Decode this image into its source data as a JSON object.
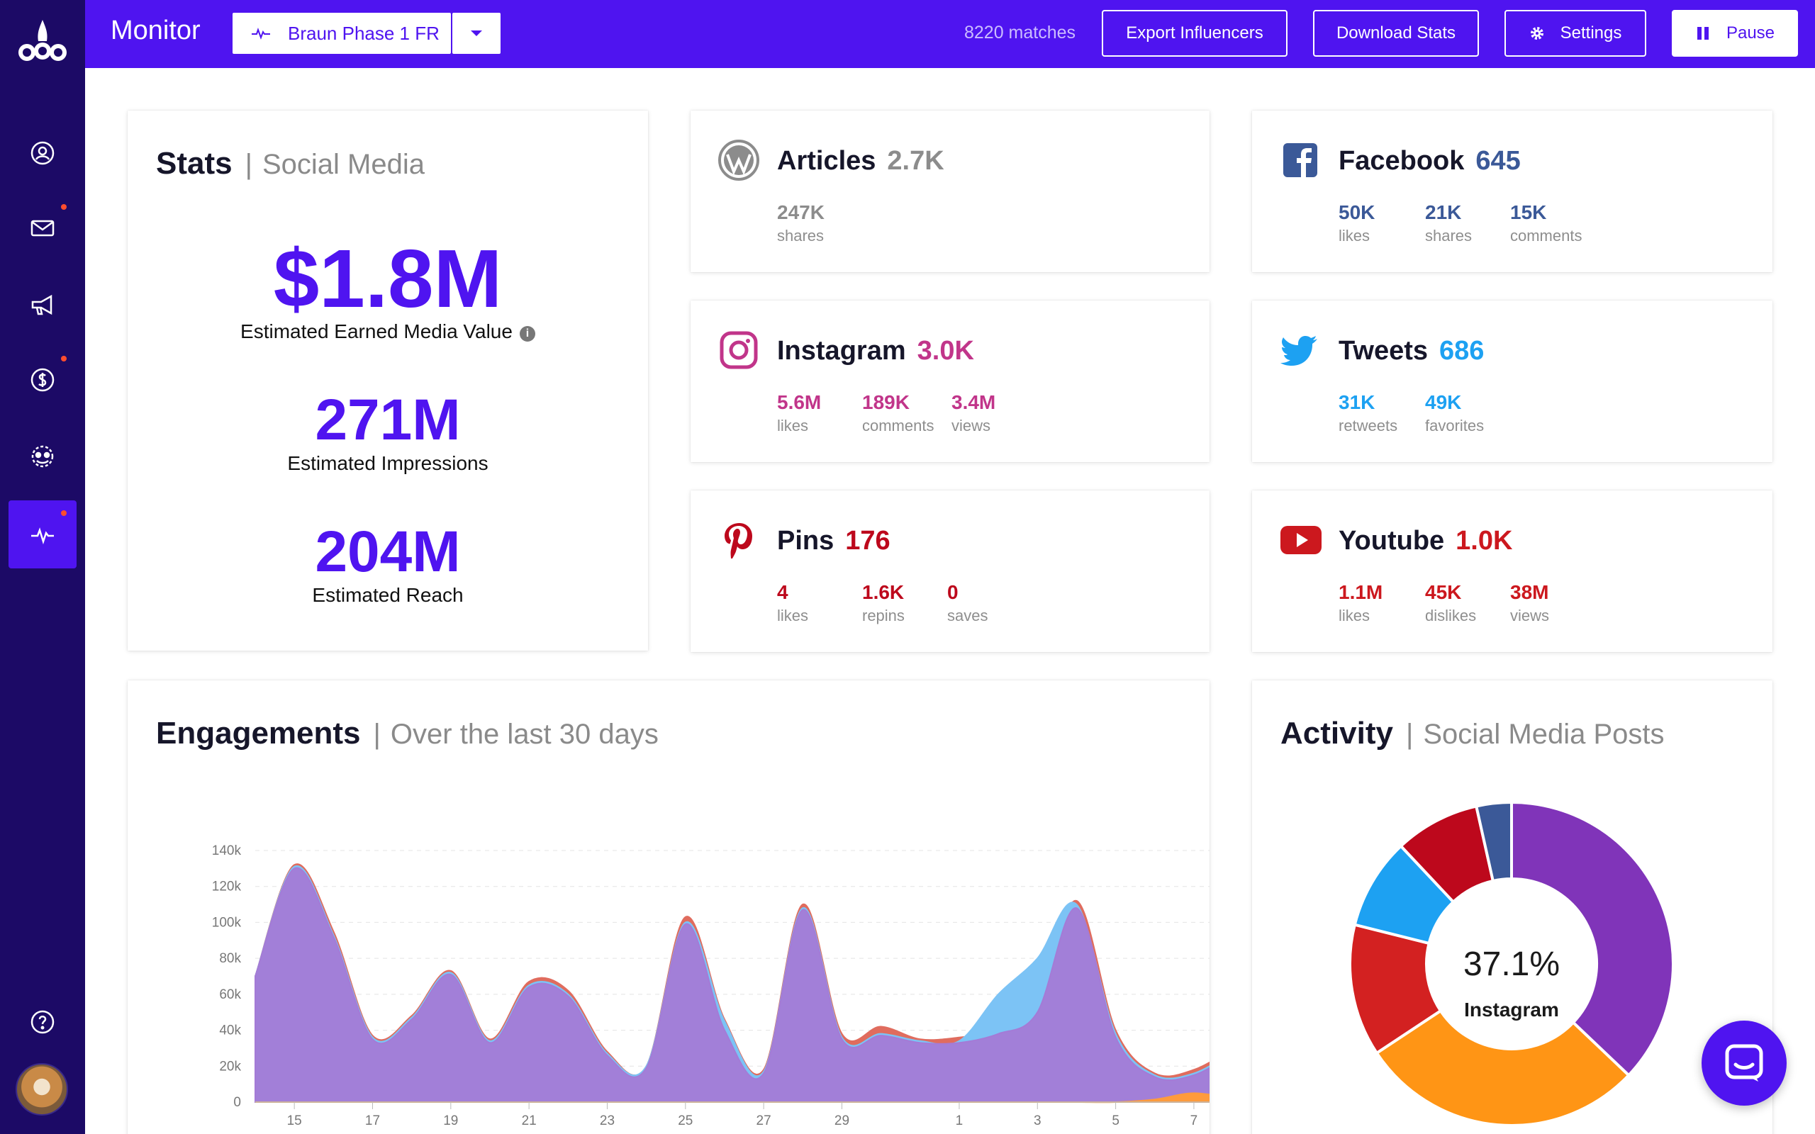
{
  "topbar": {
    "brand": "Monitor",
    "campaign": "Braun Phase 1 FR",
    "matches": "8220 matches",
    "export_label": "Export Influencers",
    "download_label": "Download Stats",
    "settings_label": "Settings",
    "pause_label": "Pause"
  },
  "sidebar": {
    "items": [
      "profile-icon",
      "mail-icon",
      "megaphone-icon",
      "dollar-icon",
      "group-icon",
      "pulse-icon",
      "help-icon"
    ],
    "active": "pulse-icon"
  },
  "stats": {
    "title": "Stats",
    "subtitle": "Social Media",
    "emv_value": "$1.8M",
    "emv_label": "Estimated Earned Media Value",
    "impressions_value": "271M",
    "impressions_label": "Estimated Impressions",
    "reach_value": "204M",
    "reach_label": "Estimated Reach"
  },
  "platforms": {
    "articles": {
      "name": "Articles",
      "count": "2.7K",
      "color": "#8c8c8c",
      "m1v": "247K",
      "m1l": "shares"
    },
    "facebook": {
      "name": "Facebook",
      "count": "645",
      "color": "#3b5998",
      "m1v": "50K",
      "m1l": "likes",
      "m2v": "21K",
      "m2l": "shares",
      "m3v": "15K",
      "m3l": "comments"
    },
    "instagram": {
      "name": "Instagram",
      "count": "3.0K",
      "color": "#c1358a",
      "m1v": "5.6M",
      "m1l": "likes",
      "m2v": "189K",
      "m2l": "comments",
      "m3v": "3.4M",
      "m3l": "views"
    },
    "tweets": {
      "name": "Tweets",
      "count": "686",
      "color": "#1da1f2",
      "m1v": "31K",
      "m1l": "retweets",
      "m2v": "49K",
      "m2l": "favorites"
    },
    "pins": {
      "name": "Pins",
      "count": "176",
      "color": "#bd081c",
      "m1v": "4",
      "m1l": "likes",
      "m2v": "1.6K",
      "m2l": "repins",
      "m3v": "0",
      "m3l": "saves"
    },
    "youtube": {
      "name": "Youtube",
      "count": "1.0K",
      "color": "#cc181e",
      "m1v": "1.1M",
      "m1l": "likes",
      "m2v": "45K",
      "m2l": "dislikes",
      "m3v": "38M",
      "m3l": "views"
    }
  },
  "engagements": {
    "title": "Engagements",
    "subtitle": "Over the last 30 days"
  },
  "activity": {
    "title": "Activity",
    "subtitle": "Social Media Posts",
    "center_value": "37.1%",
    "center_label": "Instagram"
  },
  "chart_data": [
    {
      "type": "area",
      "x": [
        "14",
        "15",
        "16",
        "17",
        "18",
        "19",
        "20",
        "21",
        "22",
        "23",
        "24",
        "25",
        "26",
        "27",
        "28",
        "29",
        "30",
        "31",
        "1",
        "2",
        "3",
        "4",
        "5",
        "6",
        "7",
        "8"
      ],
      "xticks": [
        "15",
        "17",
        "19",
        "21",
        "23",
        "25",
        "27",
        "29",
        "1",
        "3",
        "5",
        "7"
      ],
      "yticks": [
        "0",
        "20k",
        "40k",
        "60k",
        "80k",
        "100k",
        "120k",
        "140k"
      ],
      "ylim": [
        0,
        140000
      ],
      "series": [
        {
          "color": "#e06c5e",
          "values": [
            70000,
            132000,
            95000,
            37000,
            48000,
            73000,
            35000,
            67000,
            62000,
            28000,
            20000,
            103000,
            46000,
            18000,
            110000,
            38000,
            42000,
            35000,
            36000,
            40000,
            55000,
            112000,
            40000,
            16000,
            18000,
            30000
          ]
        },
        {
          "color": "#7cc3f5",
          "values": [
            70000,
            131000,
            93000,
            36000,
            47000,
            72000,
            34000,
            65000,
            60000,
            27000,
            20000,
            100000,
            45000,
            17000,
            108000,
            36000,
            38000,
            34000,
            34000,
            60000,
            80000,
            110000,
            38000,
            15000,
            16000,
            28000
          ]
        },
        {
          "color": "#a47bd6",
          "values": [
            70000,
            130000,
            92000,
            35000,
            46000,
            71000,
            33000,
            64000,
            59000,
            26000,
            19000,
            99000,
            40000,
            16000,
            107000,
            35000,
            37000,
            33000,
            33000,
            38000,
            50000,
            108000,
            36000,
            14000,
            15000,
            27000
          ]
        },
        {
          "color": "#ff9b3d",
          "values": [
            0,
            0,
            0,
            0,
            0,
            0,
            0,
            0,
            0,
            0,
            0,
            0,
            0,
            0,
            0,
            0,
            0,
            0,
            0,
            0,
            0,
            0,
            0,
            1500,
            5000,
            2000
          ]
        }
      ]
    },
    {
      "type": "pie",
      "categories": [
        "Instagram",
        "Articles",
        "Youtube",
        "Tweets",
        "Pins",
        "Facebook"
      ],
      "values": [
        37.1,
        28.6,
        13.2,
        9.1,
        8.5,
        3.5
      ],
      "colors": [
        "#8034b9",
        "#ff9515",
        "#d32121",
        "#1da1f2",
        "#bd081c",
        "#3b5998"
      ]
    }
  ]
}
